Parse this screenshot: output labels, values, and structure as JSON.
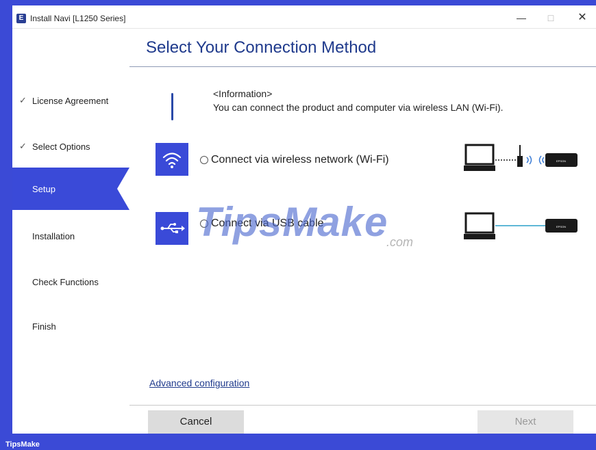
{
  "window": {
    "title": "Install Navi [L1250 Series]",
    "app_icon": "E",
    "minimize": "—",
    "maximize": "□",
    "close": "✕"
  },
  "sidebar": {
    "items": [
      {
        "label": "License Agreement",
        "done": true
      },
      {
        "label": "Select Options",
        "done": true
      },
      {
        "label": "Setup",
        "active": true
      },
      {
        "label": "Installation"
      },
      {
        "label": "Check Functions"
      },
      {
        "label": "Finish"
      }
    ],
    "check_glyph": "✓"
  },
  "main": {
    "title": "Select Your Connection Method",
    "info_title": "<Information>",
    "info_text": "You can connect the product and computer via wireless LAN (Wi-Fi).",
    "options": [
      {
        "label": "Connect via wireless network (Wi-Fi)",
        "icon": "wifi-icon"
      },
      {
        "label": "Connect via USB cable",
        "icon": "usb-icon"
      }
    ],
    "printer_brand": "EPSON",
    "advanced_link": "Advanced configuration"
  },
  "buttons": {
    "cancel": "Cancel",
    "next": "Next"
  },
  "watermark": {
    "main": "TipsMake",
    "suffix": ".com"
  },
  "footer": {
    "brand": "TipsMake"
  },
  "colors": {
    "accent": "#3a4ad8",
    "title": "#1f3a8c",
    "frame": "#3b4ad6"
  }
}
